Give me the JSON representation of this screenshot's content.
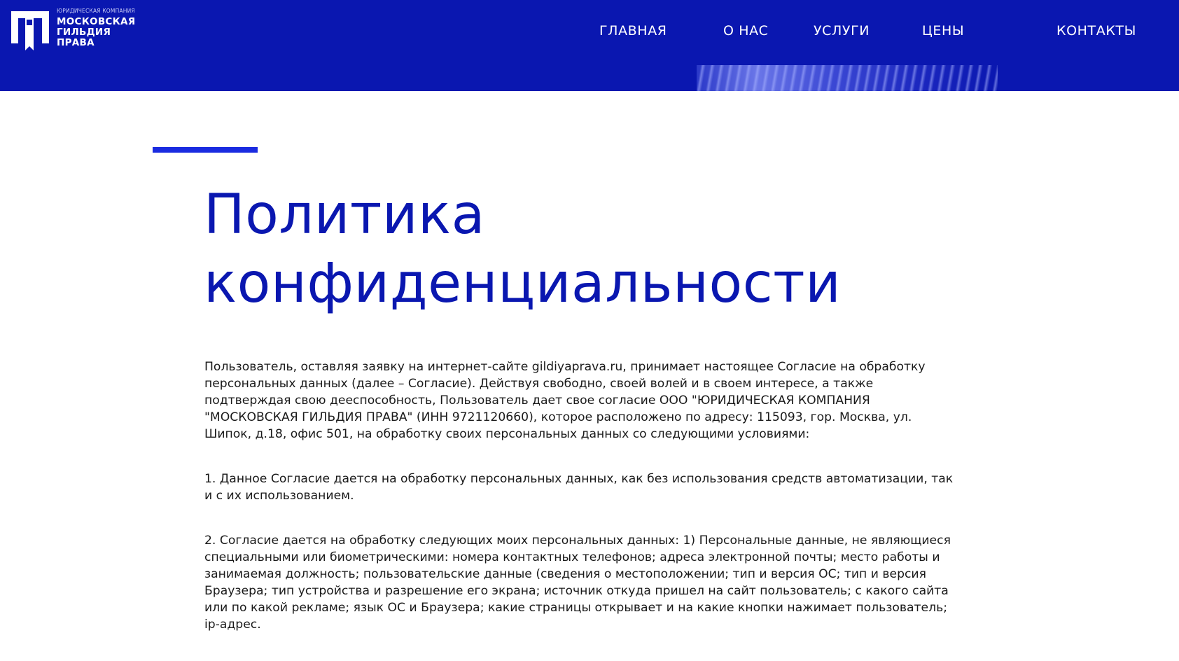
{
  "header": {
    "logo_subtitle": "ЮРИДИЧЕСКАЯ КОМПАНИЯ",
    "logo_lines": [
      "МОСКОВСКАЯ",
      "ГИЛЬДИЯ",
      "ПРАВА"
    ],
    "brand_color": "#0a17b0"
  },
  "nav": {
    "items": [
      {
        "label": "ГЛАВНАЯ"
      },
      {
        "label": "О НАС"
      },
      {
        "label": "УСЛУГИ"
      },
      {
        "label": "ЦЕНЫ"
      },
      {
        "label": "КОНТАКТЫ"
      }
    ]
  },
  "main": {
    "title_line1": "Политика",
    "title_line2": "конфиденциальности",
    "paragraphs": [
      "Пользователь, оставляя заявку на интернет-сайте gildiyaprava.ru, принимает настоящее Согласие на обработку персональных данных (далее – Согласие). Действуя свободно, своей волей и в своем интересе, а также подтверждая свою дееспособность, Пользователь дает свое согласие ООО \"ЮРИДИЧЕСКАЯ КОМПАНИЯ \"МОСКОВСКАЯ ГИЛЬДИЯ ПРАВА\" (ИНН 9721120660), которое расположено по адресу: 115093, гор. Москва, ул. Шипок, д.18, офис 501, на обработку своих персональных данных со следующими условиями:",
      "1. Данное Согласие дается на обработку персональных данных, как без использования средств автоматизации, так и с их использованием.",
      "2. Согласие дается на обработку следующих моих персональных данных: 1) Персональные данные, не являющиеся специальными или биометрическими: номера контактных телефонов; адреса электронной почты; место работы и занимаемая должность; пользовательские данные (сведения о местоположении; тип и версия ОС; тип и версия Браузера; тип устройства и разрешение его экрана; источник откуда пришел на сайт пользователь; с какого сайта или по какой рекламе; язык ОС и Браузера; какие страницы открывает и на какие кнопки нажимает пользователь; ip-адрес."
    ]
  }
}
